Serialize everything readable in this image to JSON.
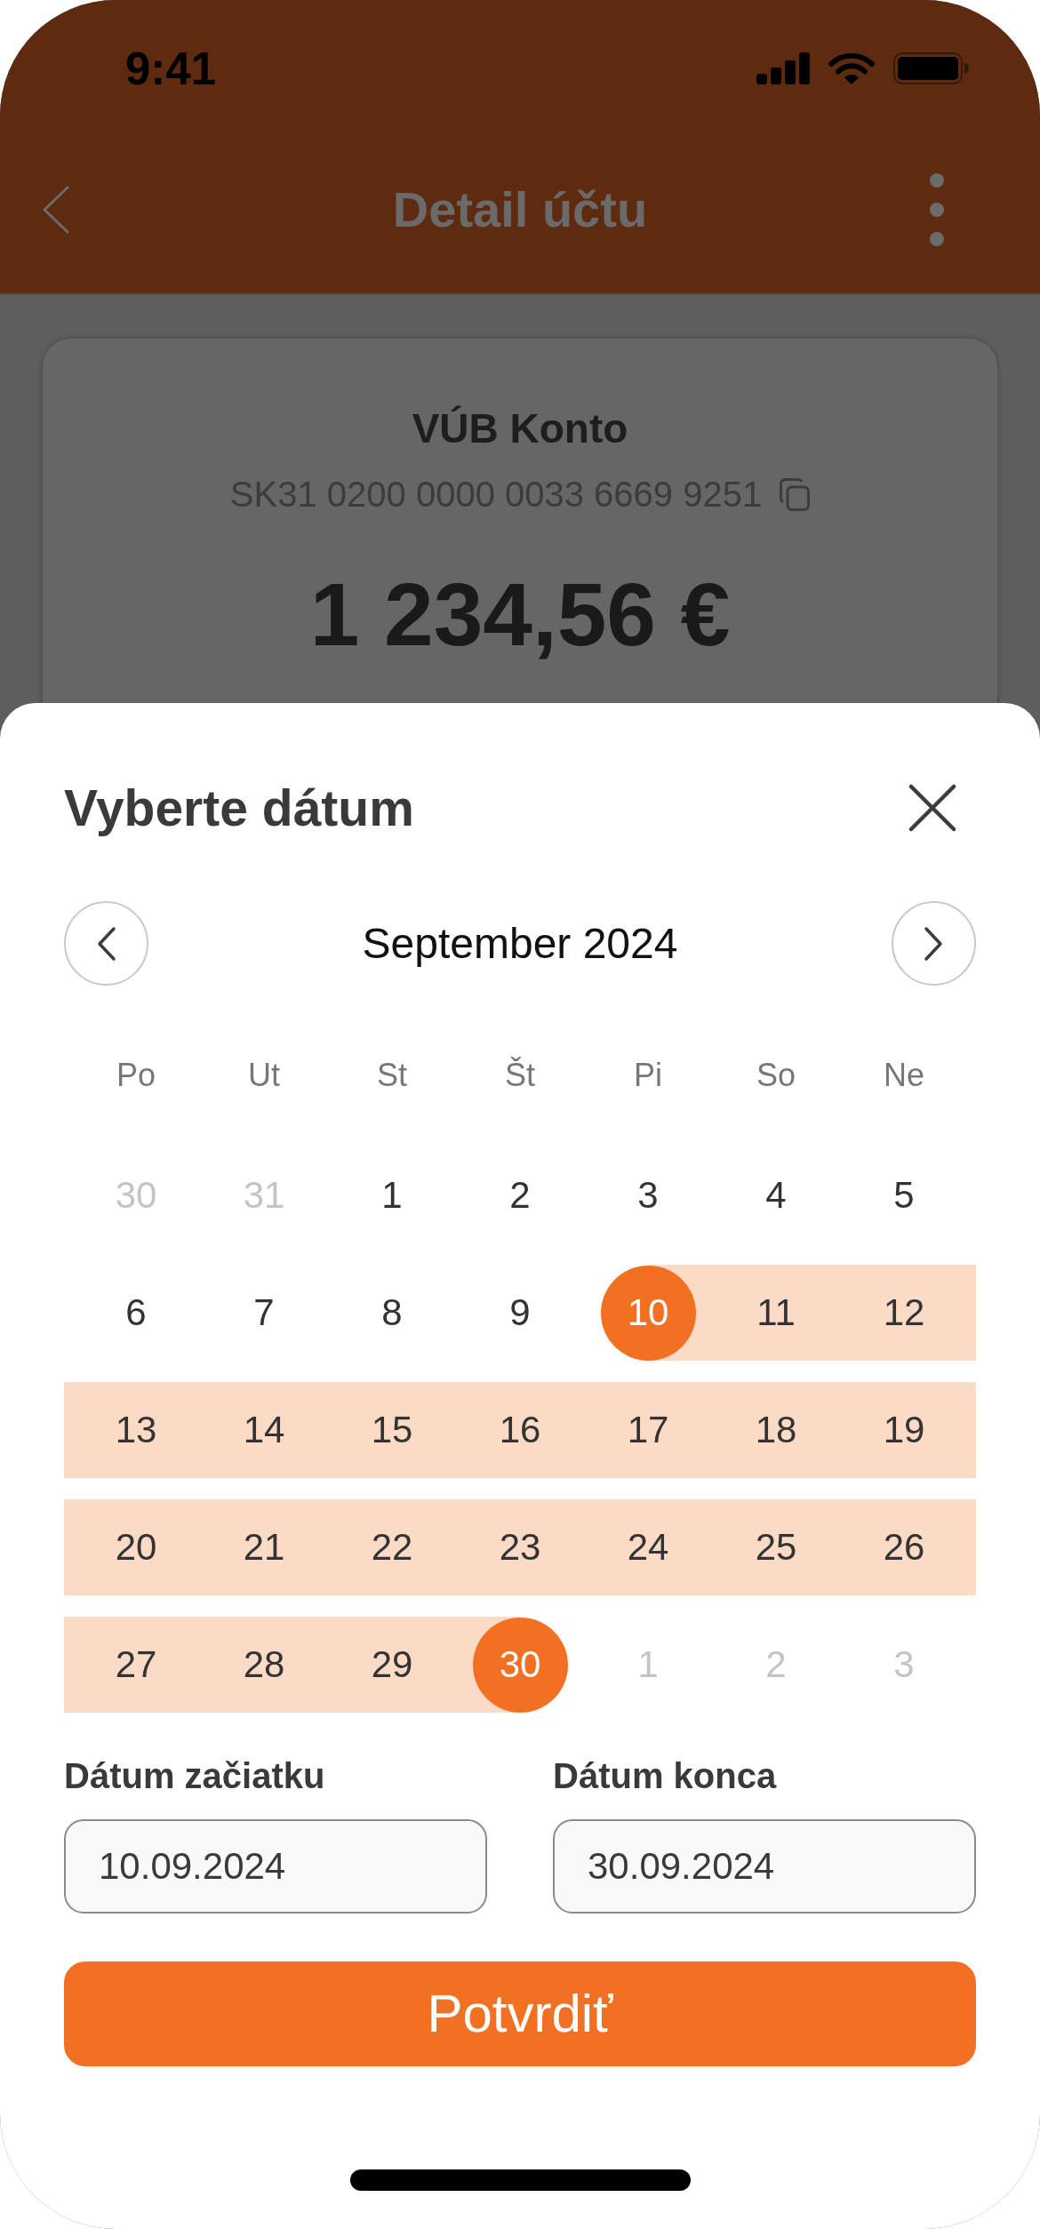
{
  "status_bar": {
    "time": "9:41"
  },
  "header": {
    "title": "Detail účtu"
  },
  "account_card": {
    "name": "VÚB Konto",
    "iban": "SK31 0200 0000 0033 6669 9251",
    "balance": "1 234,56 €"
  },
  "date_sheet": {
    "title": "Vyberte dátum",
    "month": "September 2024",
    "weekdays": [
      "Po",
      "Ut",
      "St",
      "Št",
      "Pi",
      "So",
      "Ne"
    ],
    "weeks": [
      [
        {
          "label": "30",
          "outside_month": true,
          "in_range": false,
          "selected": false
        },
        {
          "label": "31",
          "outside_month": true,
          "in_range": false,
          "selected": false
        },
        {
          "label": "1",
          "outside_month": false,
          "in_range": false,
          "selected": false
        },
        {
          "label": "2",
          "outside_month": false,
          "in_range": false,
          "selected": false
        },
        {
          "label": "3",
          "outside_month": false,
          "in_range": false,
          "selected": false
        },
        {
          "label": "4",
          "outside_month": false,
          "in_range": false,
          "selected": false
        },
        {
          "label": "5",
          "outside_month": false,
          "in_range": false,
          "selected": false
        }
      ],
      [
        {
          "label": "6",
          "outside_month": false,
          "in_range": false,
          "selected": false
        },
        {
          "label": "7",
          "outside_month": false,
          "in_range": false,
          "selected": false
        },
        {
          "label": "8",
          "outside_month": false,
          "in_range": false,
          "selected": false
        },
        {
          "label": "9",
          "outside_month": false,
          "in_range": false,
          "selected": false
        },
        {
          "label": "10",
          "outside_month": false,
          "in_range": true,
          "selected": true
        },
        {
          "label": "11",
          "outside_month": false,
          "in_range": true,
          "selected": false
        },
        {
          "label": "12",
          "outside_month": false,
          "in_range": true,
          "selected": false
        }
      ],
      [
        {
          "label": "13",
          "outside_month": false,
          "in_range": true,
          "selected": false
        },
        {
          "label": "14",
          "outside_month": false,
          "in_range": true,
          "selected": false
        },
        {
          "label": "15",
          "outside_month": false,
          "in_range": true,
          "selected": false
        },
        {
          "label": "16",
          "outside_month": false,
          "in_range": true,
          "selected": false
        },
        {
          "label": "17",
          "outside_month": false,
          "in_range": true,
          "selected": false
        },
        {
          "label": "18",
          "outside_month": false,
          "in_range": true,
          "selected": false
        },
        {
          "label": "19",
          "outside_month": false,
          "in_range": true,
          "selected": false
        }
      ],
      [
        {
          "label": "20",
          "outside_month": false,
          "in_range": true,
          "selected": false
        },
        {
          "label": "21",
          "outside_month": false,
          "in_range": true,
          "selected": false
        },
        {
          "label": "22",
          "outside_month": false,
          "in_range": true,
          "selected": false
        },
        {
          "label": "23",
          "outside_month": false,
          "in_range": true,
          "selected": false
        },
        {
          "label": "24",
          "outside_month": false,
          "in_range": true,
          "selected": false
        },
        {
          "label": "25",
          "outside_month": false,
          "in_range": true,
          "selected": false
        },
        {
          "label": "26",
          "outside_month": false,
          "in_range": true,
          "selected": false
        }
      ],
      [
        {
          "label": "27",
          "outside_month": false,
          "in_range": true,
          "selected": false
        },
        {
          "label": "28",
          "outside_month": false,
          "in_range": true,
          "selected": false
        },
        {
          "label": "29",
          "outside_month": false,
          "in_range": true,
          "selected": false
        },
        {
          "label": "30",
          "outside_month": false,
          "in_range": true,
          "selected": true
        },
        {
          "label": "1",
          "outside_month": true,
          "in_range": false,
          "selected": false
        },
        {
          "label": "2",
          "outside_month": true,
          "in_range": false,
          "selected": false
        },
        {
          "label": "3",
          "outside_month": true,
          "in_range": false,
          "selected": false
        }
      ]
    ],
    "fields": [
      {
        "label": "Dátum začiatku",
        "value": "10.09.2024"
      },
      {
        "label": "Dátum konca",
        "value": "30.09.2024"
      }
    ],
    "confirm_button": "Potvrdiť"
  }
}
